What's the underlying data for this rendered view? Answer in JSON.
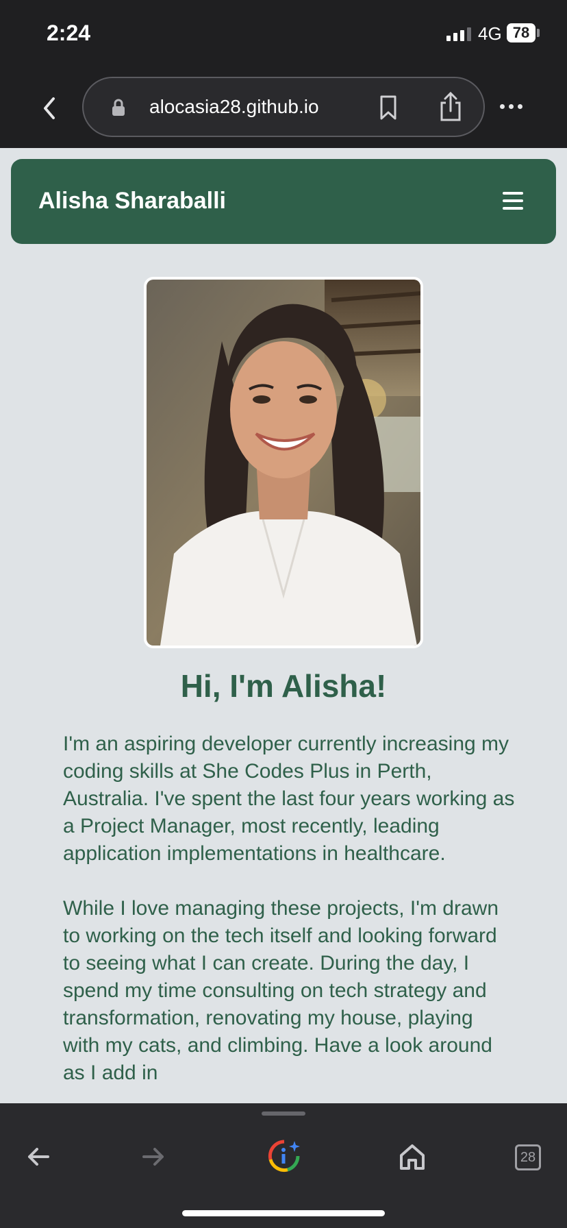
{
  "status_bar": {
    "time": "2:24",
    "network": "4G",
    "battery": "78"
  },
  "browser": {
    "url": "alocasia28.github.io",
    "tab_count": "28",
    "icons": {
      "back": "chevron-left-icon",
      "lock": "lock-icon",
      "bookmark": "bookmark-icon",
      "share": "share-icon",
      "more": "more-dots-icon"
    }
  },
  "navbar": {
    "brand": "Alisha Sharaballi",
    "menu_icon": "hamburger-icon",
    "color": "#2f604a"
  },
  "profile": {
    "photo_alt": "photo",
    "greeting": "Hi, I'm Alisha!"
  },
  "bio": {
    "paragraphs": [
      "I'm an aspiring developer currently increasing my coding skills at She Codes Plus in Perth, Australia. I've spent the last four years working as a Project Manager, most recently, leading application implementations in healthcare.",
      "While I love managing these projects, I'm drawn to working on the tech itself and looking forward to seeing what I can create. During the day, I spend my time consulting on tech strategy and transformation, renovating my house, playing with my cats, and climbing. Have a look around as I add in"
    ]
  },
  "toolbar": {
    "items": [
      "back-arrow-icon",
      "forward-arrow-icon",
      "google-lens-icon",
      "home-icon",
      "tabs-icon"
    ]
  }
}
